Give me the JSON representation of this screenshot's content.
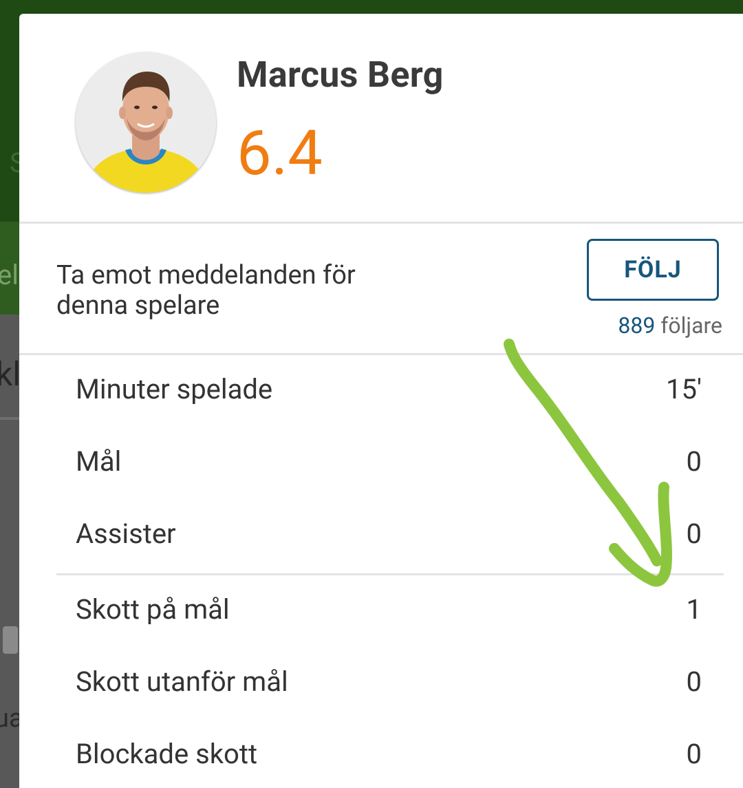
{
  "background": {
    "fragments": [
      "S",
      "el",
      "kla",
      "ua"
    ]
  },
  "player": {
    "name": "Marcus Berg",
    "rating": "6.4",
    "rating_color": "#f07d12",
    "avatar_icon": "player-photo-avatar"
  },
  "notifications": {
    "text": "Ta emot meddelanden för denna spelare",
    "follow_label": "FÖLJ",
    "follower_count": "889",
    "follower_suffix": "följare",
    "accent_color": "#17567d"
  },
  "stats": [
    {
      "label": "Minuter spelade",
      "value": "15'"
    },
    {
      "label": "Mål",
      "value": "0"
    },
    {
      "label": "Assister",
      "value": "0"
    },
    {
      "label": "Skott på mål",
      "value": "1"
    },
    {
      "label": "Skott utanför mål",
      "value": "0"
    },
    {
      "label": "Blockade skott",
      "value": "0"
    }
  ],
  "annotation": {
    "icon": "green-hand-drawn-arrow-icon",
    "color": "#8cc63f"
  }
}
